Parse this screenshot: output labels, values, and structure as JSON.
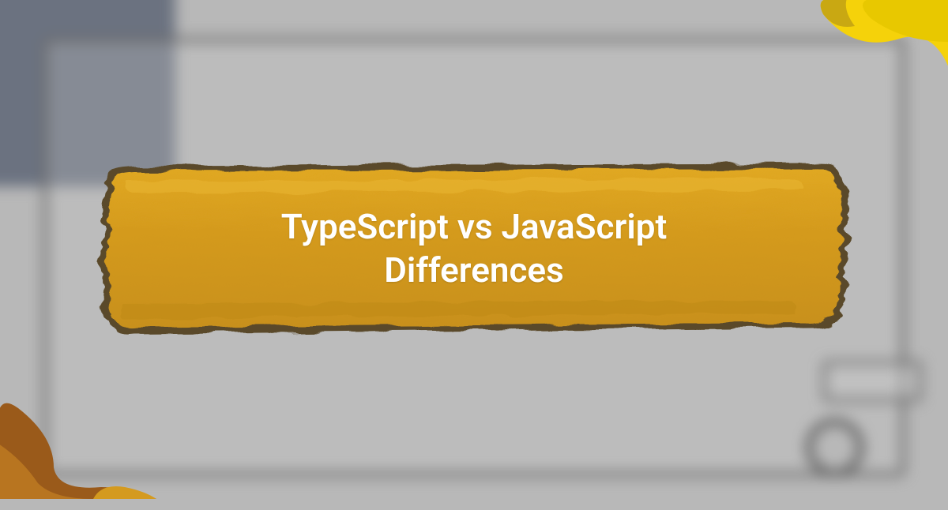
{
  "title": {
    "line1": "TypeScript vs JavaScript",
    "line2": "Differences"
  },
  "colors": {
    "brush_fill": "#d49a1f",
    "brush_dark": "#5a4a2a",
    "accent_yellow": "#f5d20a",
    "accent_brown": "#9a5a1a"
  }
}
